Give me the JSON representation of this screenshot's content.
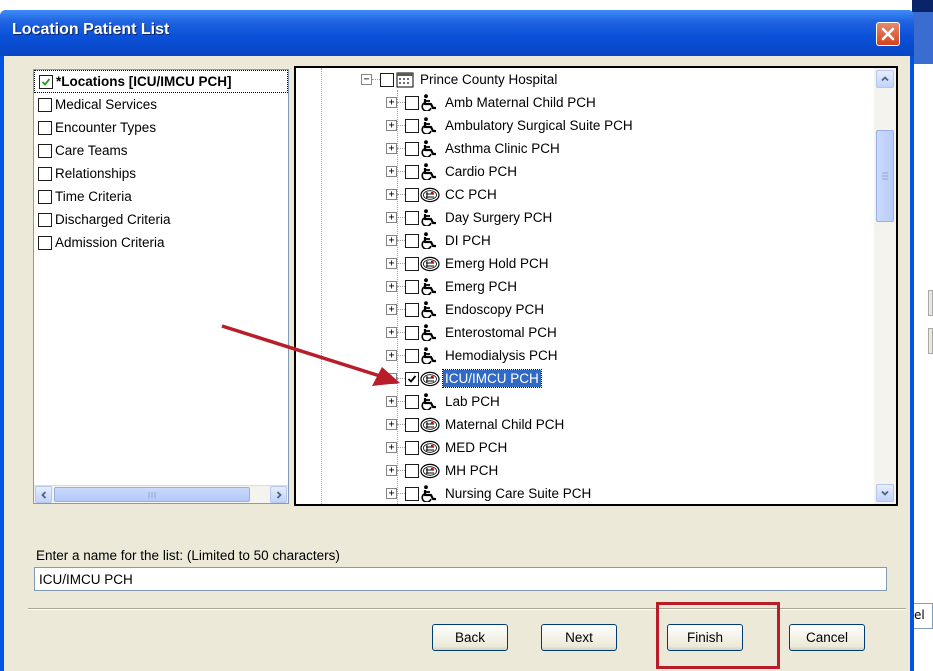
{
  "window": {
    "title": "Location Patient List",
    "close_glyph": "✕"
  },
  "criteria": {
    "items": [
      {
        "label": "*Locations [ICU/IMCU PCH]",
        "checked": true
      },
      {
        "label": "Medical Services",
        "checked": false
      },
      {
        "label": "Encounter Types",
        "checked": false
      },
      {
        "label": "Care Teams",
        "checked": false
      },
      {
        "label": "Relationships",
        "checked": false
      },
      {
        "label": "Time Criteria",
        "checked": false
      },
      {
        "label": "Discharged Criteria",
        "checked": false
      },
      {
        "label": "Admission Criteria",
        "checked": false
      }
    ]
  },
  "tree": {
    "root": {
      "label": "Prince County Hospital",
      "icon": "building-icon",
      "expander": "−"
    },
    "items": [
      {
        "label": "Amb Maternal Child PCH",
        "icon": "wheelchair-icon",
        "checked": false
      },
      {
        "label": "Ambulatory Surgical Suite PCH",
        "icon": "wheelchair-icon",
        "checked": false
      },
      {
        "label": "Asthma  Clinic PCH",
        "icon": "wheelchair-icon",
        "checked": false
      },
      {
        "label": "Cardio PCH",
        "icon": "wheelchair-icon",
        "checked": false
      },
      {
        "label": "CC PCH",
        "icon": "bed-icon",
        "checked": false
      },
      {
        "label": "Day Surgery PCH",
        "icon": "wheelchair-icon",
        "checked": false
      },
      {
        "label": "DI PCH",
        "icon": "wheelchair-icon",
        "checked": false
      },
      {
        "label": "Emerg Hold PCH",
        "icon": "bed-icon",
        "checked": false
      },
      {
        "label": "Emerg PCH",
        "icon": "wheelchair-icon",
        "checked": false
      },
      {
        "label": "Endoscopy PCH",
        "icon": "wheelchair-icon",
        "checked": false
      },
      {
        "label": "Enterostomal PCH",
        "icon": "wheelchair-icon",
        "checked": false
      },
      {
        "label": "Hemodialysis PCH",
        "icon": "wheelchair-icon",
        "checked": false
      },
      {
        "label": "ICU/IMCU PCH",
        "icon": "bed-icon",
        "checked": true,
        "selected": true
      },
      {
        "label": "Lab PCH",
        "icon": "wheelchair-icon",
        "checked": false
      },
      {
        "label": "Maternal Child PCH",
        "icon": "bed-icon",
        "checked": false
      },
      {
        "label": "MED PCH",
        "icon": "bed-icon",
        "checked": false
      },
      {
        "label": "MH PCH",
        "icon": "bed-icon",
        "checked": false
      },
      {
        "label": "Nursing Care Suite PCH",
        "icon": "wheelchair-icon",
        "checked": false
      }
    ]
  },
  "name_field": {
    "label": "Enter a name for the list: (Limited to 50 characters)",
    "value": "ICU/IMCU PCH"
  },
  "buttons": {
    "back": "Back",
    "next": "Next",
    "finish": "Finish",
    "cancel": "Cancel"
  },
  "background": {
    "partial_text": "el"
  },
  "colors": {
    "annotation_red": "#b81d2a",
    "titlebar_blue": "#0a50d8",
    "selection_blue": "#316ac5"
  }
}
